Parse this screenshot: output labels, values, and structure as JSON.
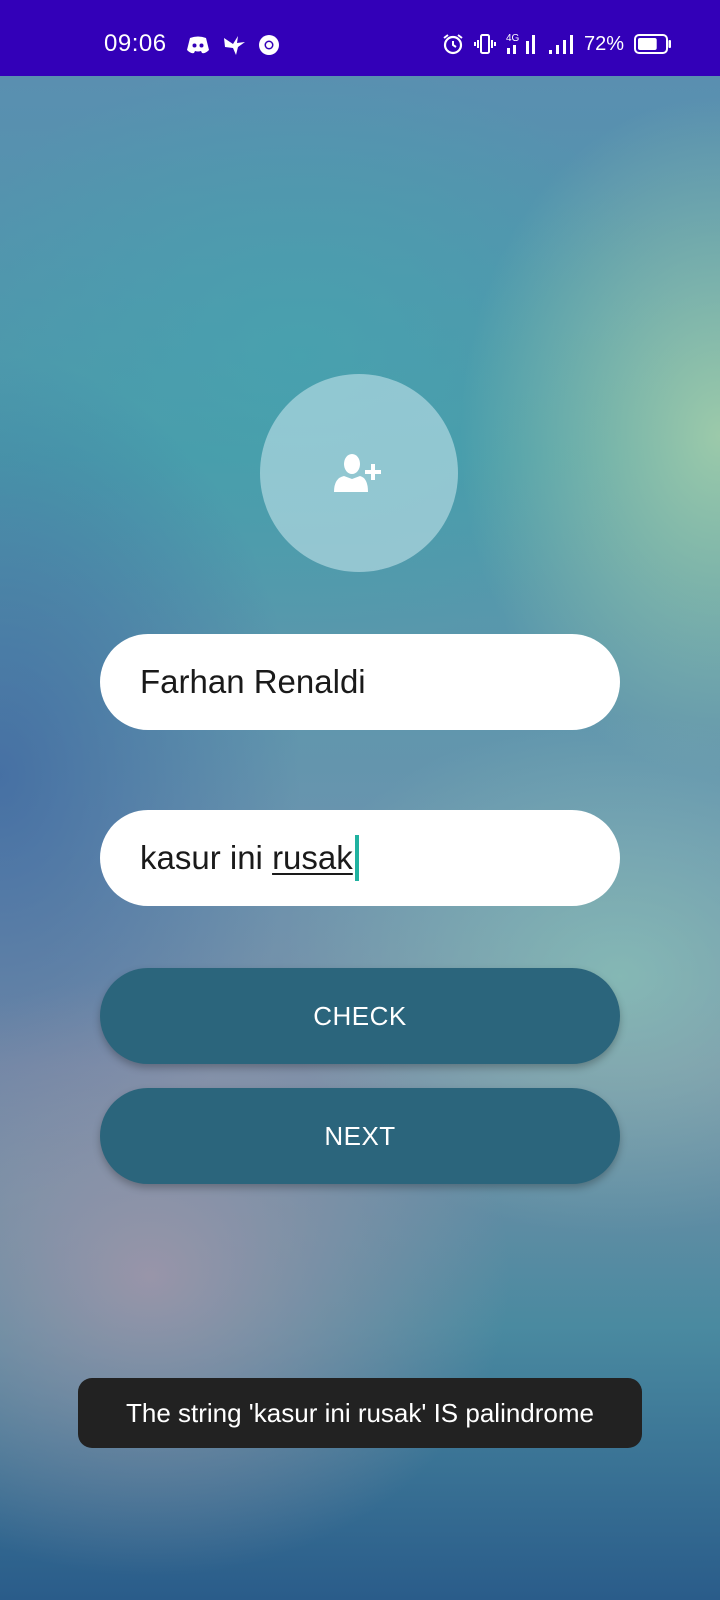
{
  "status_bar": {
    "time": "09:06",
    "left_icons": [
      "discord-icon",
      "bird-icon",
      "chrome-icon"
    ],
    "right_icons": [
      "alarm-icon",
      "vibrate-icon",
      "4g-signal-icon",
      "signal-icon",
      "battery-icon"
    ],
    "network_label": "4G",
    "battery_percent": "72%",
    "battery_level": 0.72,
    "background_color": "#3300b8"
  },
  "screen": {
    "avatar": {
      "icon": "add-user-icon"
    },
    "name_field": {
      "value": "Farhan Renaldi"
    },
    "sentence_field": {
      "value_prefix": "kasur ini ",
      "value_underlined": "rusak"
    },
    "check_button": {
      "label": "CHECK"
    },
    "next_button": {
      "label": "NEXT"
    },
    "toast": {
      "message": "The string 'kasur ini rusak' IS palindrome"
    }
  },
  "colors": {
    "button": "#2b657c",
    "caret": "#20b2a0",
    "toast": "#222222"
  }
}
